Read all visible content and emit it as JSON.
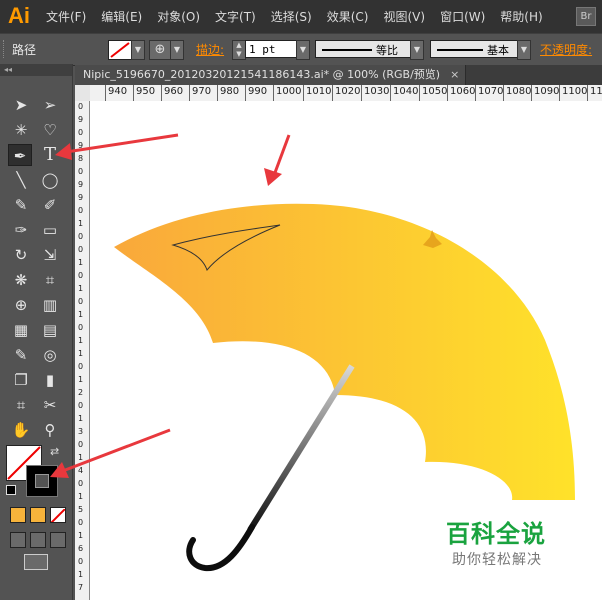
{
  "app": {
    "logo": "Ai",
    "badge": "Br"
  },
  "menu": [
    "文件(F)",
    "编辑(E)",
    "对象(O)",
    "文字(T)",
    "选择(S)",
    "效果(C)",
    "视图(V)",
    "窗口(W)",
    "帮助(H)"
  ],
  "options": {
    "object_kind": "路径",
    "stroke_label": "描边:",
    "stroke_weight": "1 pt",
    "profile_label": "等比",
    "brush_label": "基本",
    "opacity_label": "不透明度:"
  },
  "document": {
    "tab_title": "Nipic_5196670_20120320121541186143.ai*  @  100%  (RGB/预览)",
    "close_glyph": "×"
  },
  "ruler": {
    "h_labels": [
      "940",
      "950",
      "960",
      "970",
      "980",
      "990",
      "1000",
      "1010",
      "1020",
      "1030",
      "1040",
      "1050",
      "1060",
      "1070",
      "1080",
      "1090",
      "1100",
      "11"
    ],
    "v_labels": [
      "0",
      "9",
      "0",
      "9",
      "8",
      "0",
      "9",
      "9",
      "0",
      "1",
      "0",
      "0",
      "1",
      "0",
      "1",
      "0",
      "1",
      "0",
      "1",
      "1",
      "0",
      "1",
      "2",
      "0",
      "1",
      "3",
      "0",
      "1",
      "4",
      "0",
      "1",
      "5",
      "0",
      "1",
      "6",
      "0",
      "1",
      "7"
    ]
  },
  "tools": {
    "collapse_glyph": "◂◂",
    "rows": [
      [
        "➤",
        "➢"
      ],
      [
        "✳",
        "♡"
      ],
      [
        "✒",
        "T"
      ],
      [
        "╲",
        "◯"
      ],
      [
        "✎",
        "✐"
      ],
      [
        "✑",
        "▭"
      ],
      [
        "↻",
        "⇲"
      ],
      [
        "❋",
        "⌗"
      ],
      [
        "⊕",
        "▥"
      ],
      [
        "▦",
        "▤"
      ],
      [
        "✎",
        "◎"
      ],
      [
        "❐",
        "▮"
      ],
      [
        "⌗",
        "✂"
      ],
      [
        "✋",
        "⚲"
      ]
    ]
  },
  "colors": {
    "umbrella_left": "#f9a83b",
    "umbrella_right": "#ffe22a",
    "arrow_red": "#e8383d",
    "watermark_green": "#1aa33f"
  },
  "watermark": {
    "title": "百科全说",
    "subtitle": "助你轻松解决"
  }
}
